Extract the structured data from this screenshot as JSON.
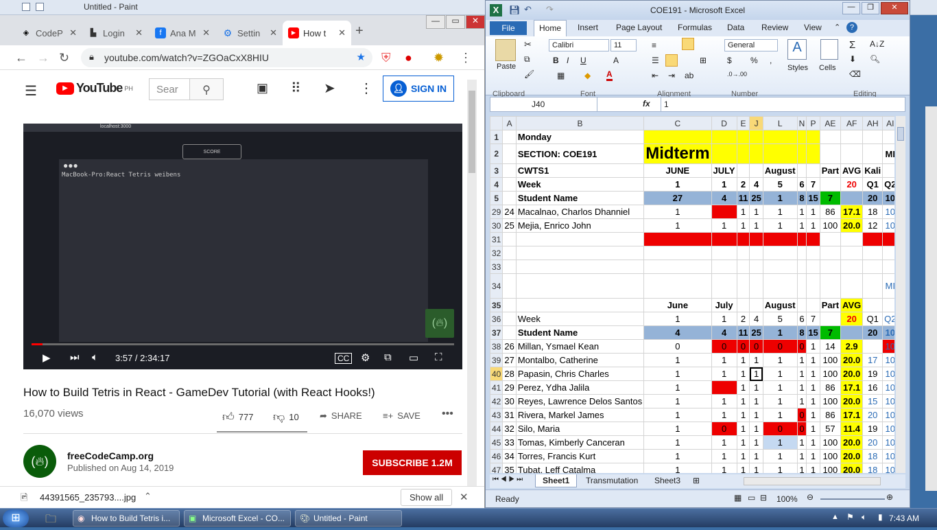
{
  "paint": {
    "title": "Untitled - Paint"
  },
  "chrome": {
    "tabs": [
      {
        "label": "CodeP",
        "icon": "codepen-icon"
      },
      {
        "label": "Login",
        "icon": "login-icon"
      },
      {
        "label": "Ana M",
        "icon": "facebook-icon"
      },
      {
        "label": "Settin",
        "icon": "settings-icon"
      },
      {
        "label": "How t",
        "icon": "youtube-icon"
      }
    ],
    "url": "youtube.com/watch?v=ZGOaCxX8HIU",
    "yt": {
      "brand": "YouTube",
      "region": "PH",
      "search_placeholder": "Sear",
      "sign_in": "SIGN IN"
    },
    "video": {
      "term_text": "MacBook-Pro:React Tetris weibens",
      "score_label": "SCORE",
      "url_text": "localhost:3000",
      "time": "3:57 / 2:34:17",
      "progress": 0.026
    },
    "title": "How to Build Tetris in React - GameDev Tutorial (with React Hooks!)",
    "views": "16,070 views",
    "likes": "777",
    "dislikes": "10",
    "share": "SHARE",
    "save": "SAVE",
    "channel": "freeCodeCamp.org",
    "published": "Published on Aug 14, 2019",
    "subscribe": "SUBSCRIBE  1.2M",
    "download": {
      "file": "44391565_235793....jpg",
      "show_all": "Show all"
    }
  },
  "excel": {
    "title": "COE191  -  Microsoft Excel",
    "tabs": [
      "File",
      "Home",
      "Insert",
      "Page Layout",
      "Formulas",
      "Data",
      "Review",
      "View"
    ],
    "font": "Calibri",
    "size": "11",
    "number_format": "General",
    "groups": [
      "Clipboard",
      "Font",
      "Alignment",
      "Number",
      "Editing"
    ],
    "labels": {
      "paste": "Paste",
      "styles": "Styles",
      "cells": "Cells"
    },
    "namebox": "J40",
    "formula": "1",
    "columns": [
      "",
      "A",
      "B",
      "C",
      "D",
      "E",
      "J",
      "L",
      "N",
      "P",
      "AE",
      "AF",
      "AH",
      "AI",
      ""
    ],
    "sheets": [
      "Sheet1",
      "Transmutation",
      "Sheet3"
    ],
    "status": "Ready",
    "zoom": "100%",
    "rows": [
      [
        "1",
        "",
        "Monday",
        "",
        "",
        "",
        "",
        "",
        "",
        "",
        "",
        "",
        "",
        ""
      ],
      [
        "2",
        "",
        "SECTION: COE191",
        "Midterm",
        "",
        "",
        "",
        "",
        "",
        "",
        "",
        "",
        "",
        "MI"
      ],
      [
        "3",
        "",
        "CWTS1",
        "JUNE",
        "JULY",
        "",
        "",
        "August",
        "",
        "",
        "Part",
        "AVG",
        "Kali",
        ""
      ],
      [
        "4",
        "",
        "Week",
        "1",
        "1",
        "2",
        "4",
        "5",
        "6",
        "7",
        "",
        "20",
        "Q1",
        "Q2"
      ],
      [
        "5",
        "",
        "Student Name",
        "27",
        "4",
        "11",
        "25",
        "1",
        "8",
        "15",
        "7",
        "",
        "20",
        "10"
      ],
      [
        "29",
        "24",
        "Macalnao, Charlos Dhanniel",
        "1",
        "",
        "1",
        "1",
        "1",
        "1",
        "1",
        "86",
        "17.1",
        "18",
        "10"
      ],
      [
        "30",
        "25",
        "Mejia, Enrico John",
        "1",
        "1",
        "1",
        "1",
        "1",
        "1",
        "1",
        "100",
        "20.0",
        "12",
        "10"
      ],
      [
        "31",
        "",
        "",
        "",
        "",
        "",
        "",
        "",
        "",
        "",
        "",
        "",
        "",
        ""
      ],
      [
        "32",
        "",
        "",
        "",
        "",
        "",
        "",
        "",
        "",
        "",
        "",
        "",
        "",
        ""
      ],
      [
        "33",
        "",
        "",
        "",
        "",
        "",
        "",
        "",
        "",
        "",
        "",
        "",
        "",
        ""
      ],
      [
        "34",
        "",
        "",
        "",
        "",
        "",
        "",
        "",
        "",
        "",
        "",
        "",
        "",
        "MI"
      ],
      [
        "35",
        "",
        "",
        "June",
        "July",
        "",
        "",
        "August",
        "",
        "",
        "Part",
        "AVG",
        "",
        ""
      ],
      [
        "36",
        "",
        "Week",
        "1",
        "1",
        "2",
        "4",
        "5",
        "6",
        "7",
        "",
        "20",
        "Q1",
        "Q2"
      ],
      [
        "37",
        "",
        "Student Name",
        "4",
        "4",
        "11",
        "25",
        "1",
        "8",
        "15",
        "7",
        "",
        "20",
        "10"
      ],
      [
        "38",
        "26",
        "Millan, Ysmael Kean",
        "0",
        "0",
        "0",
        "0",
        "0",
        "0",
        "1",
        "14",
        "2.9",
        "",
        "10"
      ],
      [
        "39",
        "27",
        "Montalbo, Catherine",
        "1",
        "1",
        "1",
        "1",
        "1",
        "1",
        "1",
        "100",
        "20.0",
        "17",
        "10"
      ],
      [
        "40",
        "28",
        "Papasin, Chris Charles",
        "1",
        "1",
        "1",
        "1",
        "1",
        "1",
        "1",
        "100",
        "20.0",
        "19",
        "10"
      ],
      [
        "41",
        "29",
        "Perez, Ydha Jalila",
        "1",
        "",
        "1",
        "1",
        "1",
        "1",
        "1",
        "86",
        "17.1",
        "16",
        "10"
      ],
      [
        "42",
        "30",
        "Reyes, Lawrence Delos Santos",
        "1",
        "1",
        "1",
        "1",
        "1",
        "1",
        "1",
        "100",
        "20.0",
        "15",
        "10"
      ],
      [
        "43",
        "31",
        "Rivera, Markel James",
        "1",
        "1",
        "1",
        "1",
        "1",
        "0",
        "1",
        "86",
        "17.1",
        "20",
        "10"
      ],
      [
        "44",
        "32",
        "Silo, Maria",
        "1",
        "0",
        "1",
        "1",
        "0",
        "0",
        "1",
        "57",
        "11.4",
        "19",
        "10"
      ],
      [
        "45",
        "33",
        "Tomas, Kimberly Canceran",
        "1",
        "1",
        "1",
        "1",
        "1",
        "1",
        "1",
        "100",
        "20.0",
        "20",
        "10"
      ],
      [
        "46",
        "34",
        "Torres, Francis Kurt",
        "1",
        "1",
        "1",
        "1",
        "1",
        "1",
        "1",
        "100",
        "20.0",
        "18",
        "10"
      ],
      [
        "47",
        "35",
        "Tubat, Leff Catalma",
        "1",
        "1",
        "1",
        "1",
        "1",
        "1",
        "1",
        "100",
        "20.0",
        "18",
        "10"
      ]
    ]
  },
  "taskbar": {
    "items": [
      "How to Build Tetris i...",
      "Microsoft Excel - CO...",
      "Untitled - Paint"
    ],
    "time": "7:43 AM"
  }
}
